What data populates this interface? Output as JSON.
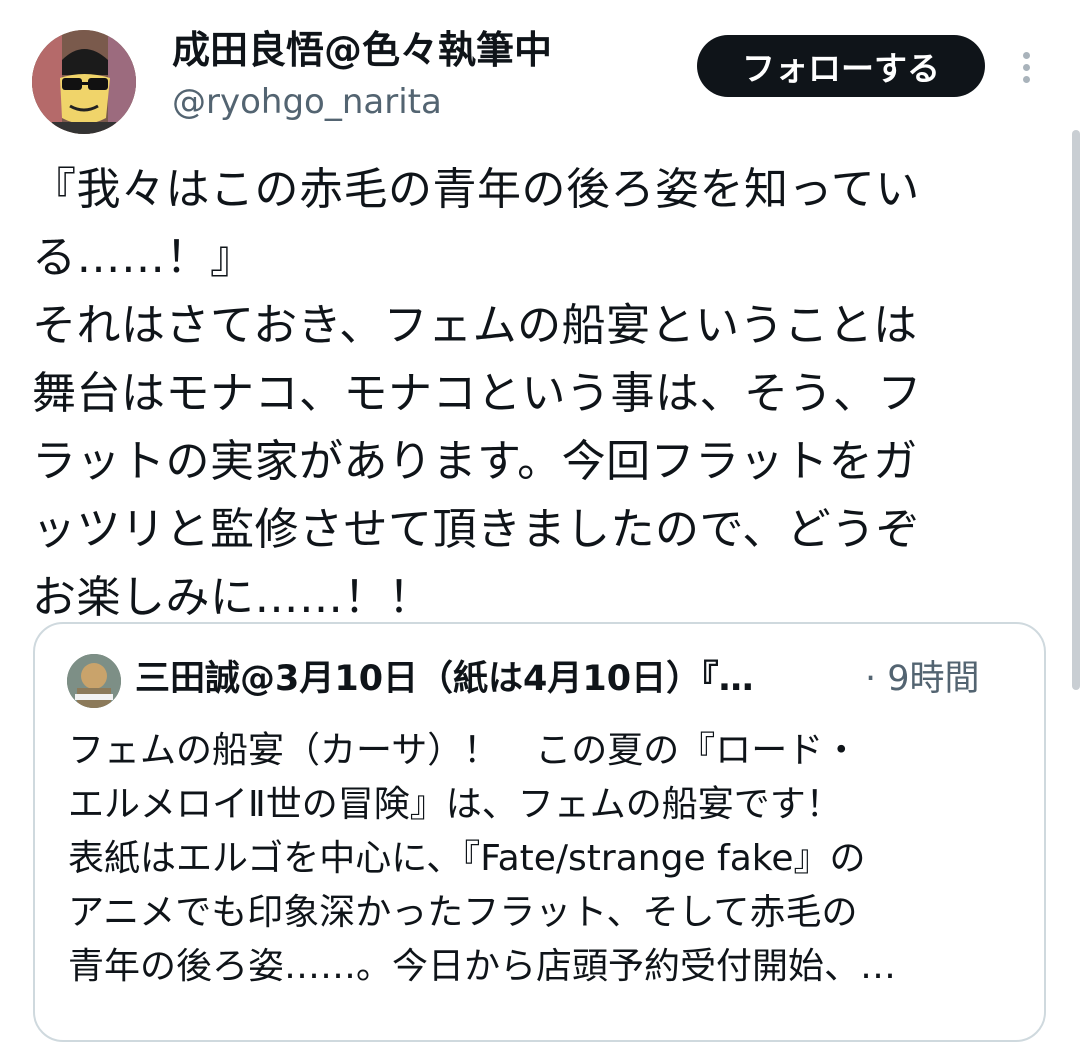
{
  "tweet": {
    "author": {
      "display_name": "成田良悟@色々執筆中",
      "handle": "@ryohgo_narita",
      "avatar_icon": "user-avatar-icon"
    },
    "follow_label": "フォローする",
    "more_icon": "more-vertical-icon",
    "text": "『我々はこの赤毛の青年の後ろ姿を知ってい\nる……！』\nそれはさておき、フェムの船宴ということは\n舞台はモナコ、モナコという事は、そう、フ\nラットの実家があります。今回フラットをガ\nッツリと監修させて頂きましたので、どうぞ\nお楽しみに……！！"
  },
  "quoted_tweet": {
    "author_name": "三田誠@3月10日（紙は4月10日）『…",
    "time": "· 9時間",
    "avatar_icon": "quoted-user-avatar-icon",
    "text": "フェムの船宴（カーサ）！　この夏の『ロード・\nエルメロイⅡ世の冒険』は、フェムの船宴です！\n表紙はエルゴを中心に、『Fate/strange fake』の\nアニメでも印象深かったフラット、そして赤毛の\n青年の後ろ姿……。今日から店頭予約受付開始、…"
  },
  "colors": {
    "text_primary": "#0f1419",
    "text_secondary": "#536471",
    "button_bg": "#0f1419",
    "border": "#cfd9de"
  }
}
